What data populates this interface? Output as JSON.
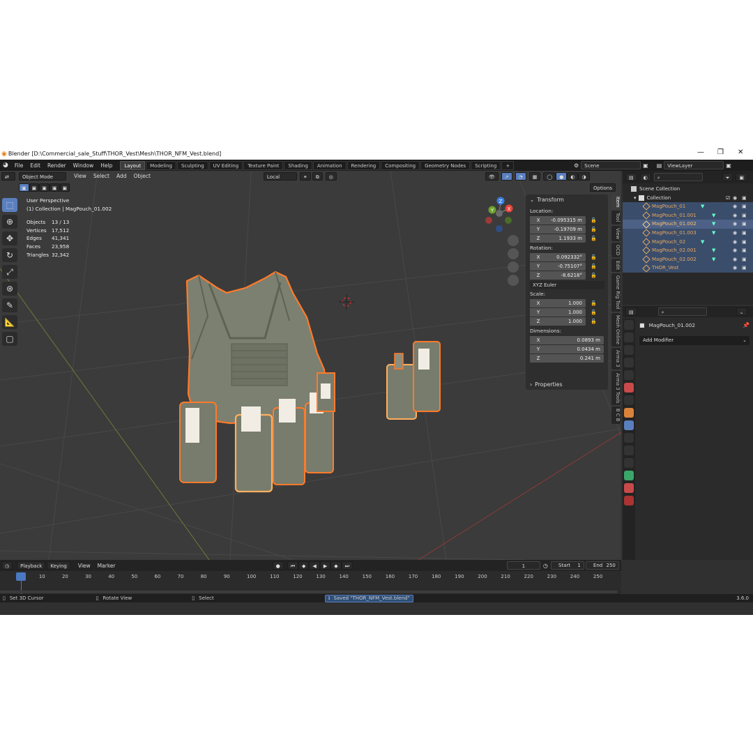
{
  "window": {
    "title": "Blender [D:\\Commercial_sale_Stuff\\THOR_Vest\\Mesh\\THOR_NFM_Vest.blend]",
    "controls": [
      "—",
      "❐",
      "✕"
    ]
  },
  "menubar": {
    "items": [
      "File",
      "Edit",
      "Render",
      "Window",
      "Help"
    ]
  },
  "workspaces": [
    "Layout",
    "Modeling",
    "Sculpting",
    "UV Editing",
    "Texture Paint",
    "Shading",
    "Animation",
    "Rendering",
    "Compositing",
    "Geometry Nodes",
    "Scripting"
  ],
  "active_workspace": "Layout",
  "add_workspace": "+",
  "scene": {
    "label": "Scene",
    "viewlayer": "ViewLayer"
  },
  "viewport_header": {
    "mode": "Object Mode",
    "menus": [
      "View",
      "Select",
      "Add",
      "Object"
    ],
    "orientation": "Local",
    "options": "Options"
  },
  "overlay": {
    "perspective": "User Perspective",
    "context": "(1) Collection | MagPouch_01.002",
    "stats": [
      {
        "label": "Objects",
        "value": "13 / 13"
      },
      {
        "label": "Vertices",
        "value": "17,512"
      },
      {
        "label": "Edges",
        "value": "41,341"
      },
      {
        "label": "Faces",
        "value": "23,958"
      },
      {
        "label": "Triangles",
        "value": "32,342"
      }
    ]
  },
  "gizmo_axes": [
    "X",
    "Y",
    "Z"
  ],
  "transform": {
    "header": "Transform",
    "location_label": "Location:",
    "location": [
      [
        "X",
        "-0.095315 m"
      ],
      [
        "Y",
        "-0.19709 m"
      ],
      [
        "Z",
        "1.1933 m"
      ]
    ],
    "rotation_label": "Rotation:",
    "rotation": [
      [
        "X",
        "0.092332°"
      ],
      [
        "Y",
        "-0.75107°"
      ],
      [
        "Z",
        "-8.6218°"
      ]
    ],
    "rotation_mode": "XYZ Euler",
    "scale_label": "Scale:",
    "scale": [
      [
        "X",
        "1.000"
      ],
      [
        "Y",
        "1.000"
      ],
      [
        "Z",
        "1.000"
      ]
    ],
    "dimensions_label": "Dimensions:",
    "dimensions": [
      [
        "X",
        "0.0893 m"
      ],
      [
        "Y",
        "0.0434 m"
      ],
      [
        "Z",
        "0.241 m"
      ]
    ],
    "properties": "Properties"
  },
  "sidebar_tabs": [
    "Item",
    "Tool",
    "View",
    "OCD",
    "Edit",
    "Game Rig Tool",
    "Mesh Online",
    "Arma 3",
    "Arma 3 Tools",
    "B C B"
  ],
  "outliner": {
    "root": "Scene Collection",
    "collection": "Collection",
    "items": [
      "MagPouch_01",
      "MagPouch_01.001",
      "MagPouch_01.002",
      "MagPouch_01.003",
      "MagPouch_02",
      "MagPouch_02.001",
      "MagPouch_02.002",
      "THOR_Vest"
    ],
    "selected": "MagPouch_01.002"
  },
  "properties_panel": {
    "object_name": "MagPouch_01.002",
    "add_modifier": "Add Modifier"
  },
  "timeline": {
    "menus": [
      "Playback",
      "Keying",
      "View",
      "Marker"
    ],
    "current_frame": "1",
    "start_label": "Start",
    "start": "1",
    "end_label": "End",
    "end": "250",
    "ticks": [
      "1",
      "10",
      "20",
      "30",
      "40",
      "50",
      "60",
      "70",
      "80",
      "90",
      "100",
      "110",
      "120",
      "130",
      "140",
      "150",
      "160",
      "170",
      "180",
      "190",
      "200",
      "210",
      "220",
      "230",
      "240",
      "250"
    ]
  },
  "statusbar": {
    "left": "Set 3D Cursor",
    "middle": "Rotate View",
    "right": "Select",
    "message": "Saved \"THOR_NFM_Vest.blend\"",
    "version": "3.6.0"
  },
  "colors": {
    "accent": "#5a7fbf",
    "selection_outline": "#ff7a2a",
    "active_outline": "#ffb060",
    "vest": "#7c8070",
    "pouch": "#787c6c",
    "mag_insert": "#f1ece4"
  }
}
